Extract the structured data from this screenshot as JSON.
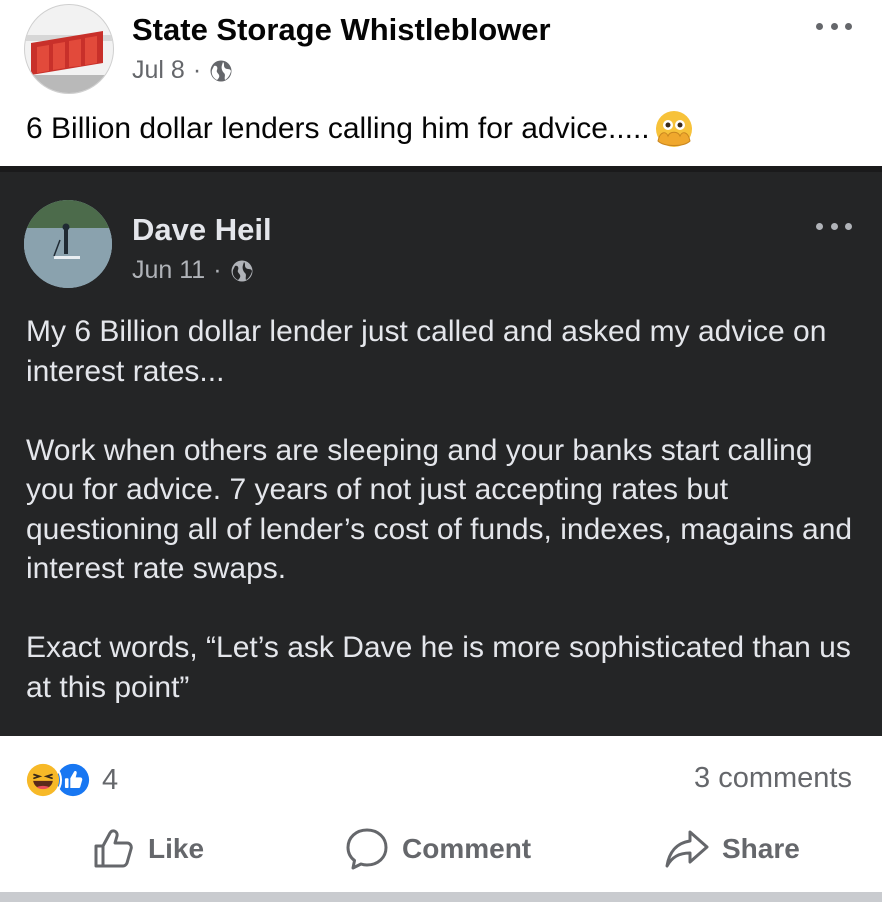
{
  "post": {
    "author": "State Storage Whistleblower",
    "date": "Jul 8",
    "separator": "·",
    "privacy_icon": "globe-icon",
    "caption": "6 Billion dollar lenders calling him for advice.....",
    "caption_emoji": "face-with-open-eyes-and-hand-over-mouth"
  },
  "shared_post": {
    "author": "Dave Heil",
    "date": "Jun 11",
    "separator": "·",
    "privacy_icon": "globe-icon",
    "paragraphs": [
      "My 6 Billion dollar lender just called and asked my advice on interest rates...",
      "Work when others are sleeping and your banks start calling you for advice. 7 years of not just accepting rates but questioning all of lender’s cost of funds, indexes, magains and interest rate swaps.",
      "Exact words, “Let’s ask Dave he is more sophisticated than us at this point”"
    ]
  },
  "reactions": {
    "types": [
      "haha",
      "like"
    ],
    "count": "4",
    "comments": "3 comments"
  },
  "actions": {
    "like": "Like",
    "comment": "Comment",
    "share": "Share"
  },
  "colors": {
    "dark_background": "#242526",
    "meta_gray": "#65676b",
    "like_blue": "#1877f2",
    "haha_yellow": "#f7b928"
  }
}
